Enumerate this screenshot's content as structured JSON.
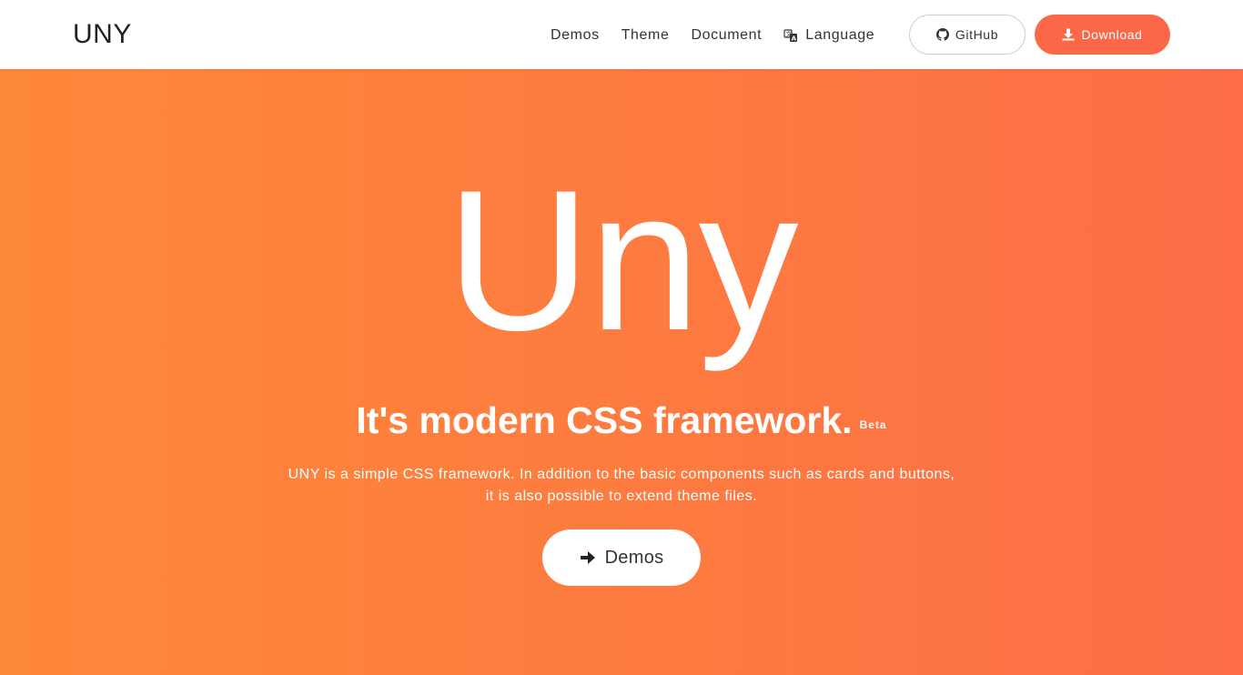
{
  "header": {
    "brand": "UNY",
    "nav": [
      {
        "label": "Demos"
      },
      {
        "label": "Theme"
      },
      {
        "label": "Document"
      },
      {
        "label": "Language",
        "icon": "translate-icon"
      }
    ],
    "github_label": "GitHub",
    "download_label": "Download"
  },
  "hero": {
    "logo_text": "Uny",
    "title": "It's modern CSS framework.",
    "badge": "Beta",
    "description_line1": "UNY is a simple CSS framework. In addition to the basic components such as cards and buttons,",
    "description_line2": "it is also possible to extend theme files.",
    "cta_label": "Demos"
  },
  "colors": {
    "accent": "#fb6747",
    "hero_gradient_start": "#fe8839",
    "hero_gradient_end": "#fc6d48",
    "text_dark": "#333333"
  }
}
